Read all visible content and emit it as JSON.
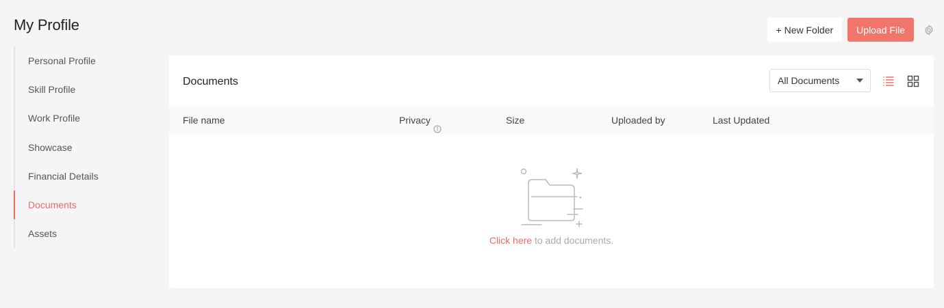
{
  "page": {
    "title": "My Profile"
  },
  "sidebar": {
    "items": [
      {
        "label": "Personal Profile",
        "active": false
      },
      {
        "label": "Skill Profile",
        "active": false
      },
      {
        "label": "Work Profile",
        "active": false
      },
      {
        "label": "Showcase",
        "active": false
      },
      {
        "label": "Financial Details",
        "active": false
      },
      {
        "label": "Documents",
        "active": true
      },
      {
        "label": "Assets",
        "active": false
      }
    ]
  },
  "actions": {
    "new_folder_label": "+ New Folder",
    "upload_label": "Upload File",
    "settings_icon": "gear-icon"
  },
  "documents": {
    "title": "Documents",
    "filter": {
      "selected": "All Documents"
    },
    "view_modes": {
      "list_icon": "list-view-icon",
      "grid_icon": "grid-view-icon",
      "active": "list"
    },
    "columns": {
      "file_name": "File name",
      "privacy": "Privacy",
      "size": "Size",
      "uploaded_by": "Uploaded by",
      "last_updated": "Last Updated"
    },
    "empty_state": {
      "link_text": "Click here",
      "text": " to add documents."
    }
  },
  "colors": {
    "accent": "#ee6a5f",
    "upload_button": "#f2756b",
    "background": "#f5f5f5"
  }
}
